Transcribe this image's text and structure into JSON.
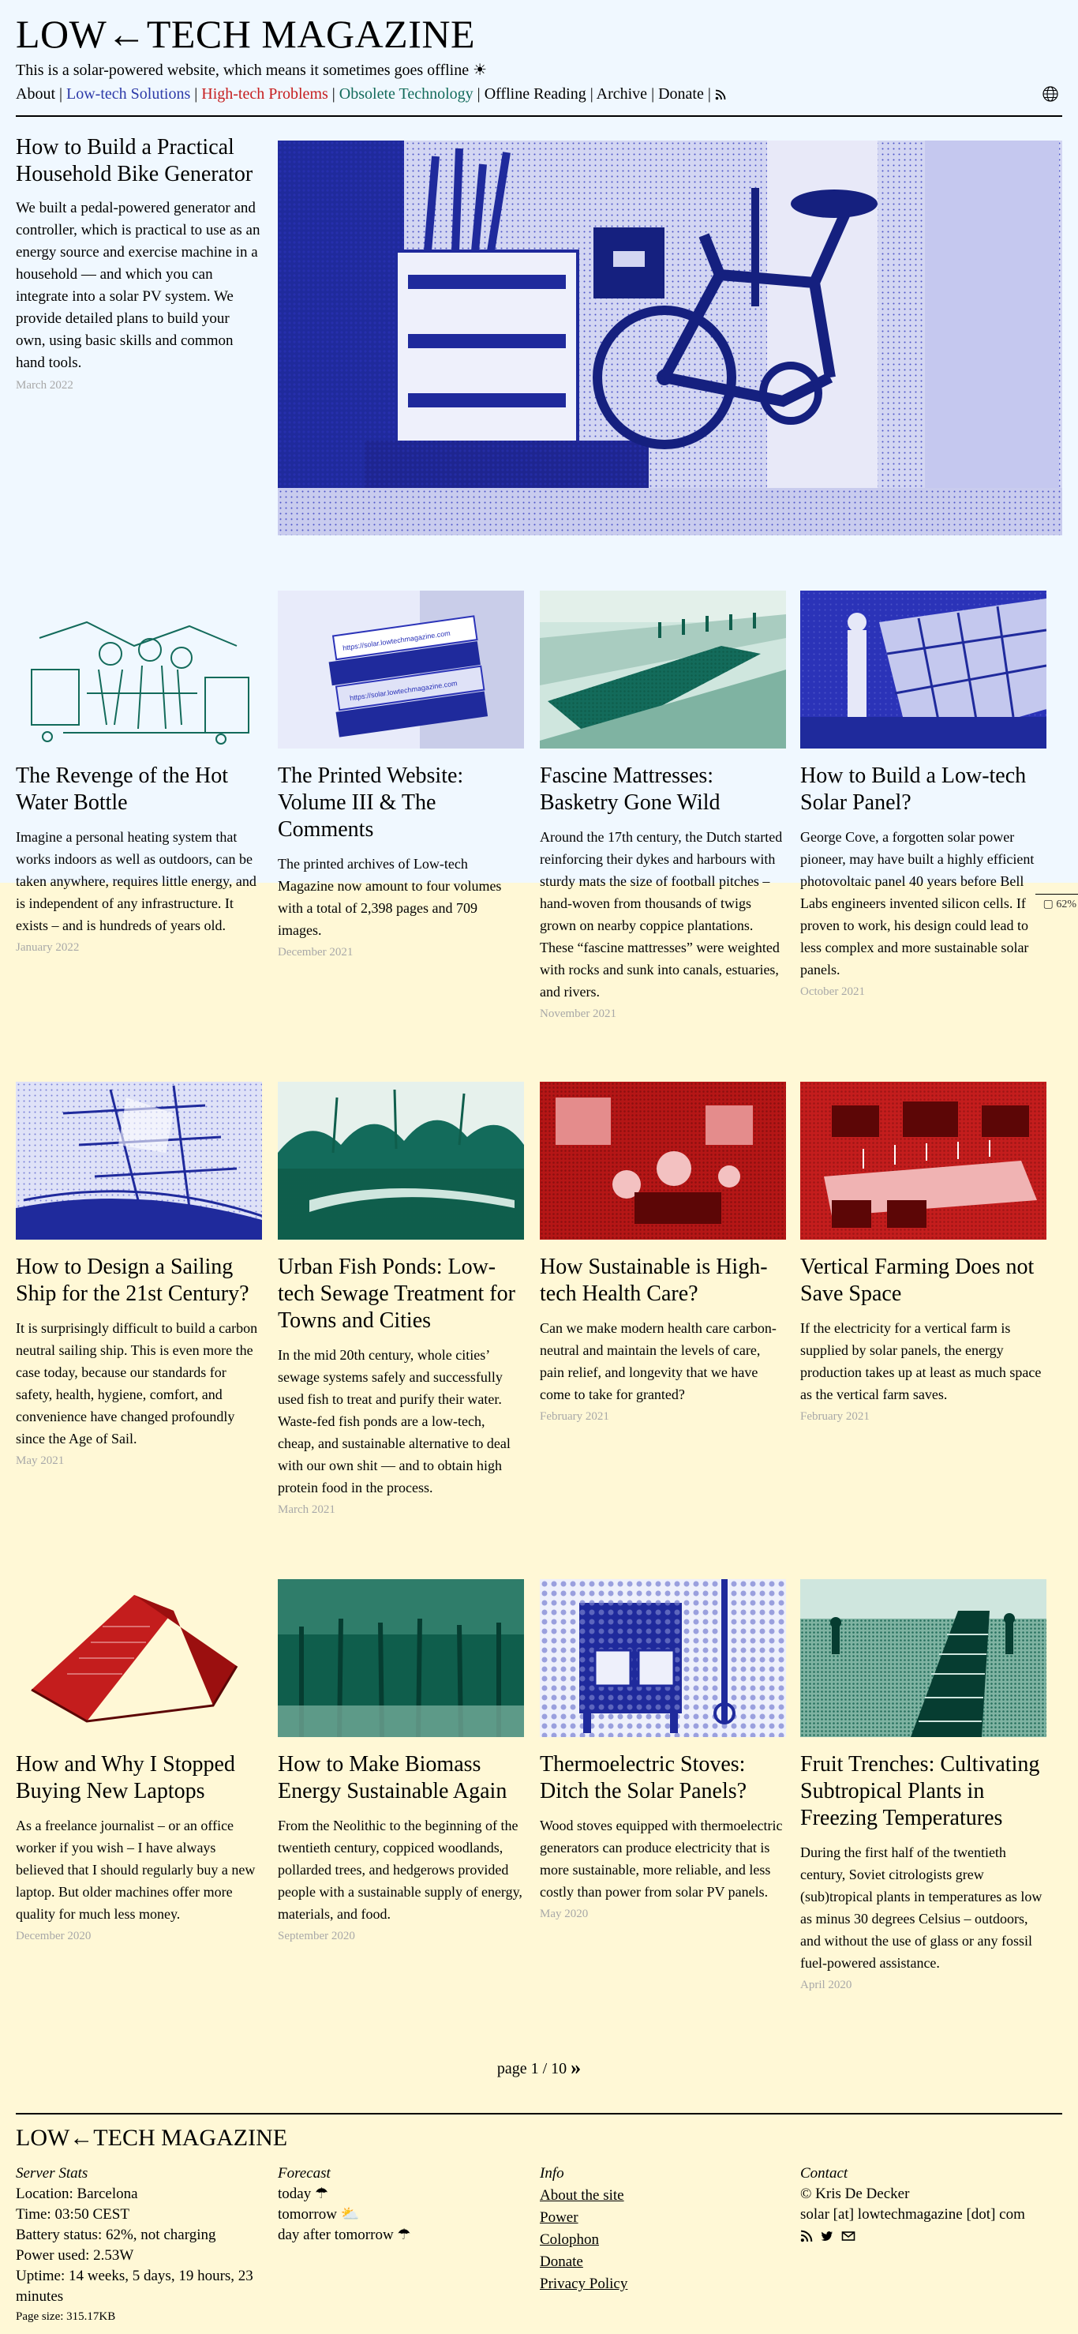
{
  "header": {
    "title": "LOW←TECH MAGAZINE",
    "tagline": "This is a solar-powered website, which means it sometimes goes offline ☀",
    "nav": [
      {
        "label": "About",
        "color": "#000000"
      },
      {
        "label": "Low-tech Solutions",
        "color": "#2d3aa8"
      },
      {
        "label": "High-tech Problems",
        "color": "#c61e1e"
      },
      {
        "label": "Obsolete Technology",
        "color": "#136b5b"
      },
      {
        "label": "Offline Reading",
        "color": "#000000"
      },
      {
        "label": "Archive",
        "color": "#000000"
      },
      {
        "label": "Donate",
        "color": "#000000"
      }
    ],
    "rss_icon": "rss-icon",
    "language_icon": "globe-icon"
  },
  "battery_indicator": "62%",
  "feature": {
    "title": "How to Build a Practical Household Bike Generator",
    "summary": "We built a pedal-powered generator and controller, which is practical to use as an energy source and exercise machine in a household — and which you can integrate into a solar PV system. We provide detailed plans to build your own, using basic skills and common hand tools.",
    "date": "March 2022"
  },
  "rows": [
    [
      {
        "title": "The Revenge of the Hot Water Bottle",
        "summary": "Imagine a personal heating system that works indoors as well as outdoors, can be taken anywhere, requires little energy, and is independent of any infrastructure. It exists – and is hundreds of years old.",
        "date": "January 2022"
      },
      {
        "title": "The Printed Website: Volume III & The Comments",
        "summary": "The printed archives of Low-tech Magazine now amount to four volumes with a total of 2,398 pages and 709 images.",
        "date": "December 2021"
      },
      {
        "title": "Fascine Mattresses: Basketry Gone Wild",
        "summary": "Around the 17th century, the Dutch started reinforcing their dykes and harbours with sturdy mats the size of football pitches – hand-woven from thousands of twigs grown on nearby coppice plantations. These “fascine mattresses” were weighted with rocks and sunk into canals, estuaries, and rivers.",
        "date": "November 2021"
      },
      {
        "title": "How to Build a Low-tech Solar Panel?",
        "summary": "George Cove, a forgotten solar power pioneer, may have built a highly efficient photovoltaic panel 40 years before Bell Labs engineers invented silicon cells. If proven to work, his design could lead to less complex and more sustainable solar panels.",
        "date": "October 2021"
      }
    ],
    [
      {
        "title": "How to Design a Sailing Ship for the 21st Century?",
        "summary": "It is surprisingly difficult to build a carbon neutral sailing ship. This is even more the case today, because our standards for safety, health, hygiene, comfort, and convenience have changed profoundly since the Age of Sail.",
        "date": "May 2021"
      },
      {
        "title": "Urban Fish Ponds: Low-tech Sewage Treatment for Towns and Cities",
        "summary": "In the mid 20th century, whole cities’ sewage systems safely and successfully used fish to treat and purify their water. Waste-fed fish ponds are a low-tech, cheap, and sustainable alternative to deal with our own shit — and to obtain high protein food in the process.",
        "date": "March 2021"
      },
      {
        "title": "How Sustainable is High-tech Health Care?",
        "summary": "Can we make modern health care carbon-neutral and maintain the levels of care, pain relief, and longevity that we have come to take for granted?",
        "date": "February 2021"
      },
      {
        "title": "Vertical Farming Does not Save Space",
        "summary": "If the electricity for a vertical farm is supplied by solar panels, the energy production takes up at least as much space as the vertical farm saves.",
        "date": "February 2021"
      }
    ],
    [
      {
        "title": "How and Why I Stopped Buying New Laptops",
        "summary": "As a freelance journalist – or an office worker if you wish – I have always believed that I should regularly buy a new laptop. But older machines offer more quality for much less money.",
        "date": "December 2020"
      },
      {
        "title": "How to Make Biomass Energy Sustainable Again",
        "summary": "From the Neolithic to the beginning of the twentieth century, coppiced woodlands, pollarded trees, and hedgerows provided people with a sustainable supply of energy, materials, and food.",
        "date": "September 2020"
      },
      {
        "title": "Thermoelectric Stoves: Ditch the Solar Panels?",
        "summary": "Wood stoves equipped with thermoelectric generators can produce electricity that is more sustainable, more reliable, and less costly than power from solar PV panels.",
        "date": "May 2020"
      },
      {
        "title": "Fruit Trenches: Cultivating Subtropical Plants in Freezing Temperatures",
        "summary": "During the first half of the twentieth century, Soviet citrologists grew (sub)tropical plants in temperatures as low as minus 30 degrees Celsius – outdoors, and without the use of glass or any fossil fuel-powered assistance.",
        "date": "April 2020"
      }
    ]
  ],
  "pager": {
    "text": "page 1 / 10",
    "next": "»"
  },
  "footer": {
    "title": "LOW←TECH MAGAZINE",
    "stats": {
      "heading": "Server Stats",
      "lines": [
        "Location: Barcelona",
        "Time: 03:50 CEST",
        "Battery status: 62%, not charging",
        "Power used: 2.53W",
        "Uptime: 14 weeks, 5 days, 19 hours, 23 minutes"
      ]
    },
    "forecast": {
      "heading": "Forecast",
      "lines": [
        "today ☂",
        "tomorrow ⛅",
        "day after tomorrow ☂"
      ]
    },
    "info": {
      "heading": "Info",
      "links": [
        "About the site",
        "Power",
        "Colophon",
        "Donate",
        "Privacy Policy"
      ]
    },
    "contact": {
      "heading": "Contact",
      "lines": [
        "© Kris De Decker",
        "solar [at] lowtechmagazine [dot] com"
      ],
      "icons": [
        "rss-icon",
        "twitter-icon",
        "mail-icon"
      ]
    },
    "page_size": "Page size: 315.17KB"
  }
}
